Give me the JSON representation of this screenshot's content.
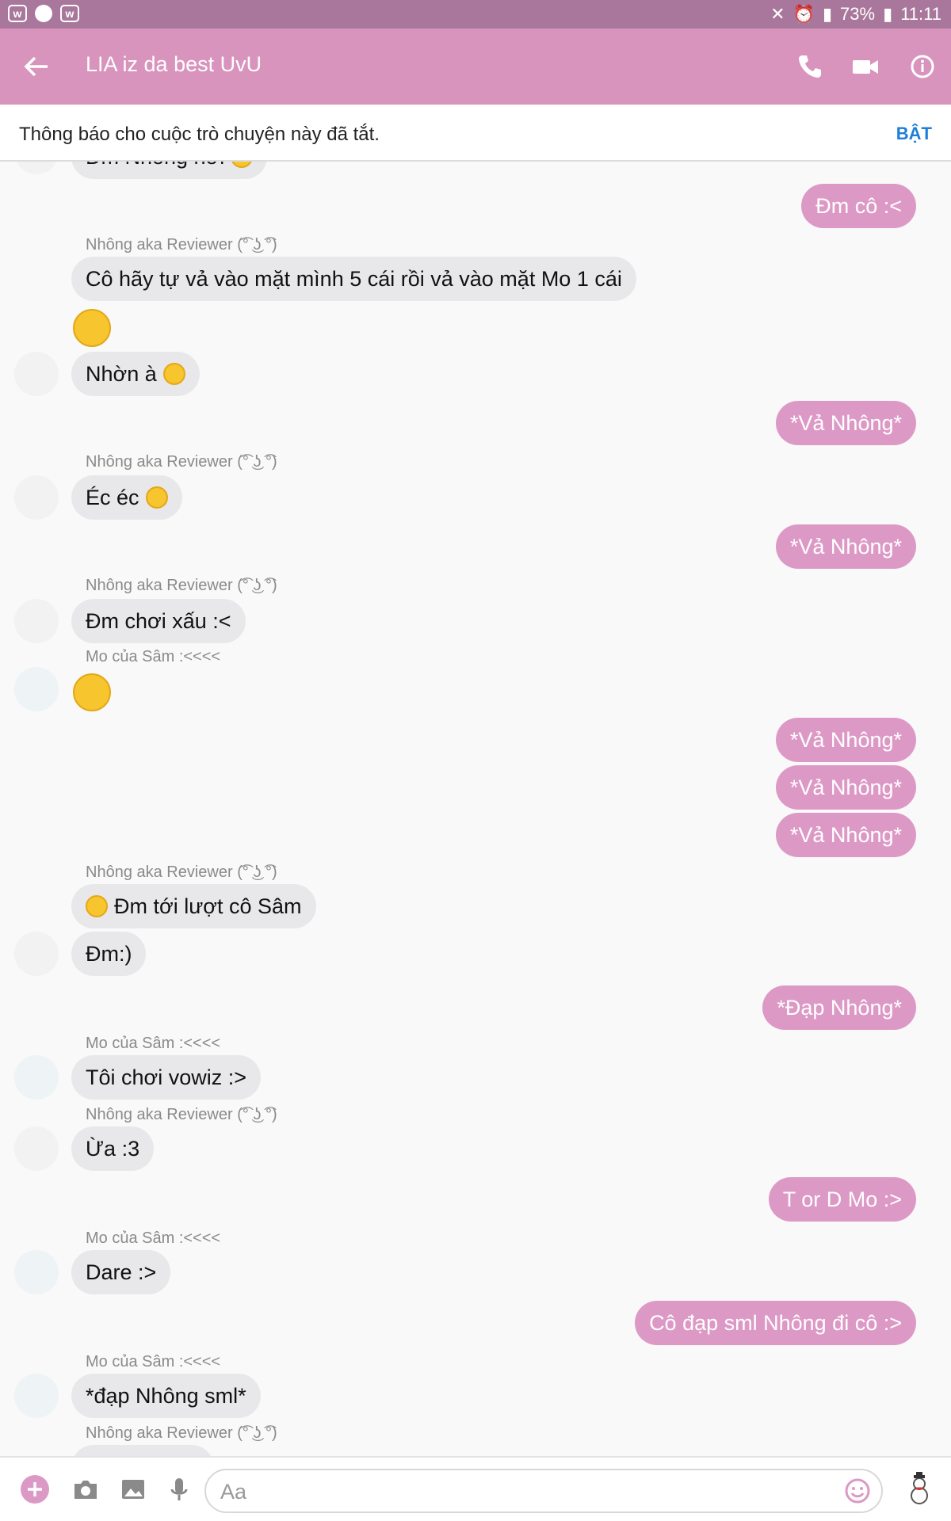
{
  "statusbar": {
    "battery": "73%",
    "time": "11:11",
    "app_icon_letter": "w"
  },
  "header": {
    "title": "LIA iz da best UvU"
  },
  "notice": {
    "text": "Thông báo cho cuộc trò chuyện này đã tắt.",
    "button": "BẬT"
  },
  "messages": [
    {
      "sender": "",
      "text": "Đm Nhông hơi"
    },
    {
      "out": "Đm cô :<"
    },
    {
      "sender": "Nhông aka Reviewer (͡° ͜ʖ ͡°)",
      "text": "Cô hãy tự vả vào mặt mình 5 cái rồi vả vào mặt Mo 1 cái"
    },
    {
      "text": "Nhờn à"
    },
    {
      "out": "*Vả Nhông*"
    },
    {
      "sender": "Nhông aka Reviewer (͡° ͜ʖ ͡°)",
      "text": "Éc éc"
    },
    {
      "out": "*Vả Nhông*"
    },
    {
      "sender": "Nhông aka Reviewer (͡° ͜ʖ ͡°)",
      "text": "Đm chơi xấu :<"
    },
    {
      "sender": "Mo của Sâm :<<<<"
    },
    {
      "out": "*Vả Nhông*"
    },
    {
      "out": "*Vả Nhông*"
    },
    {
      "out": "*Vả Nhông*"
    },
    {
      "sender": "Nhông aka Reviewer (͡° ͜ʖ ͡°)",
      "text": "Đm tới lượt cô Sâm"
    },
    {
      "text": "Đm:)"
    },
    {
      "out": "*Đạp Nhông*"
    },
    {
      "sender": "Mo của Sâm :<<<<",
      "text": "Tôi chơi vowiz :>"
    },
    {
      "sender": "Nhông aka Reviewer (͡° ͜ʖ ͡°)",
      "text": "Ừa :3"
    },
    {
      "out": "T or D Mo :>"
    },
    {
      "sender": "Mo của Sâm :<<<<",
      "text": "Dare :>"
    },
    {
      "out": "Cô đạp sml Nhông đi cô :>"
    },
    {
      "sender": "Mo của Sâm :<<<<",
      "text": "*đạp Nhông sml*"
    },
    {
      "sender": "Nhông aka Reviewer (͡° ͜ʖ ͡°)"
    }
  ],
  "composer": {
    "placeholder": "Aa"
  },
  "colors": {
    "header": "#d894bd",
    "statusbar": "#a8779b",
    "outgoing": "#dd99c6",
    "incoming": "#e8e8ea",
    "accent": "#1e7fd8"
  },
  "icons": [
    "back-arrow-icon",
    "phone-icon",
    "video-camera-icon",
    "info-icon",
    "plus-icon",
    "camera-icon",
    "image-icon",
    "microphone-icon",
    "emoji-icon",
    "snowman-sticker-icon"
  ]
}
